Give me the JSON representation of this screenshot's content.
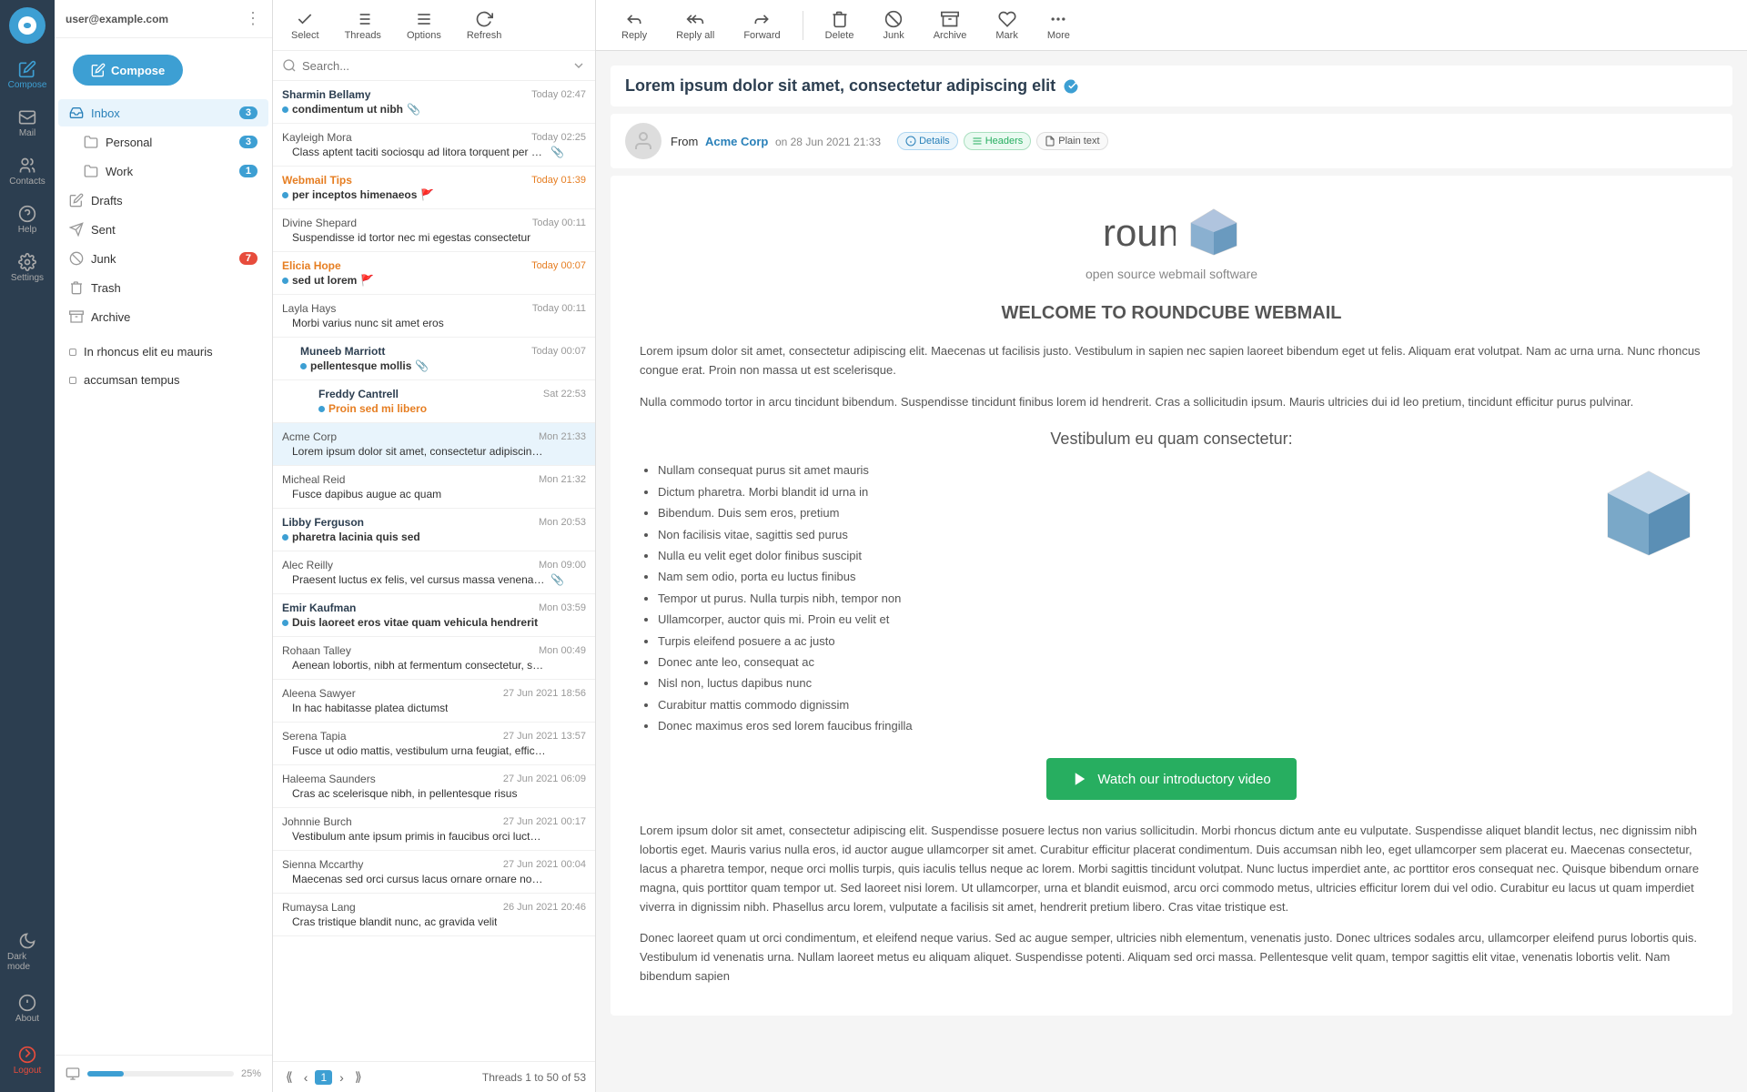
{
  "app": {
    "title": "Roundcube Webmail",
    "user_email": "user@example.com"
  },
  "sidebar": {
    "compose_label": "Compose",
    "nav_items": [
      {
        "id": "compose",
        "label": "Compose",
        "icon": "compose-icon",
        "active": true
      },
      {
        "id": "mail",
        "label": "Mail",
        "icon": "mail-icon"
      },
      {
        "id": "contacts",
        "label": "Contacts",
        "icon": "contacts-icon"
      },
      {
        "id": "help",
        "label": "Help",
        "icon": "help-icon"
      },
      {
        "id": "settings",
        "label": "Settings",
        "icon": "settings-icon"
      }
    ],
    "bottom_items": [
      {
        "id": "darkmode",
        "label": "Dark mode",
        "icon": "moon-icon"
      },
      {
        "id": "about",
        "label": "About",
        "icon": "question-icon"
      },
      {
        "id": "logout",
        "label": "Logout",
        "icon": "power-icon"
      }
    ]
  },
  "folders": {
    "inbox": {
      "label": "Inbox",
      "badge": 3,
      "active": true
    },
    "sub_folders": [
      {
        "label": "Personal",
        "badge": 3
      },
      {
        "label": "Work",
        "badge": 1
      }
    ],
    "drafts": {
      "label": "Drafts",
      "badge": null
    },
    "sent": {
      "label": "Sent",
      "badge": null
    },
    "junk": {
      "label": "Junk",
      "badge": 7
    },
    "trash": {
      "label": "Trash",
      "badge": null
    },
    "archive": {
      "label": "Archive",
      "badge": null
    },
    "custom_folders": [
      {
        "label": "In rhoncus elit eu mauris"
      },
      {
        "label": "accumsan tempus"
      }
    ]
  },
  "toolbar": {
    "buttons": [
      {
        "id": "reply",
        "label": "Reply",
        "icon": "reply-icon"
      },
      {
        "id": "reply-all",
        "label": "Reply all",
        "icon": "reply-all-icon"
      },
      {
        "id": "forward",
        "label": "Forward",
        "icon": "forward-icon"
      },
      {
        "id": "delete",
        "label": "Delete",
        "icon": "delete-icon"
      },
      {
        "id": "junk",
        "label": "Junk",
        "icon": "junk-icon"
      },
      {
        "id": "archive",
        "label": "Archive",
        "icon": "archive-icon"
      },
      {
        "id": "mark",
        "label": "Mark",
        "icon": "mark-icon"
      },
      {
        "id": "more",
        "label": "More",
        "icon": "more-icon"
      }
    ]
  },
  "message_list_toolbar": {
    "select_label": "Select",
    "threads_label": "Threads",
    "options_label": "Options",
    "refresh_label": "Refresh"
  },
  "search": {
    "placeholder": "Search..."
  },
  "messages": [
    {
      "id": 1,
      "sender": "Sharmin Bellamy",
      "subject": "condimentum ut nibh",
      "time": "Today 02:47",
      "unread": true,
      "attachment": true,
      "flag": false,
      "indent": 0,
      "today": false
    },
    {
      "id": 2,
      "sender": "Kayleigh Mora",
      "subject": "Class aptent taciti sociosqu ad litora torquent per conubia nostra",
      "time": "Today 02:25",
      "unread": false,
      "attachment": true,
      "flag": false,
      "indent": 0,
      "today": false
    },
    {
      "id": 3,
      "sender": "Webmail Tips",
      "subject": "per inceptos himenaeos",
      "time": "Today 01:39",
      "unread": true,
      "attachment": false,
      "flag": true,
      "indent": 0,
      "today": true,
      "sender_colored": true
    },
    {
      "id": 4,
      "sender": "Divine Shepard",
      "subject": "Suspendisse id tortor nec mi egestas consectetur",
      "time": "Today 00:11",
      "unread": false,
      "attachment": false,
      "flag": false,
      "indent": 0,
      "today": false
    },
    {
      "id": 5,
      "sender": "Elicia Hope",
      "subject": "sed ut lorem",
      "time": "Today 00:07",
      "unread": true,
      "attachment": false,
      "flag": true,
      "indent": 0,
      "today": true,
      "sender_colored": true
    },
    {
      "id": 6,
      "sender": "Layla Hays",
      "subject": "Morbi varius nunc sit amet eros",
      "time": "Today 00:11",
      "unread": false,
      "attachment": false,
      "flag": false,
      "indent": 0,
      "today": false
    },
    {
      "id": 7,
      "sender": "Muneeb Marriott",
      "subject": "pellentesque mollis",
      "time": "Today 00:07",
      "unread": true,
      "attachment": true,
      "flag": false,
      "indent": 1,
      "today": false
    },
    {
      "id": 8,
      "sender": "Freddy Cantrell",
      "subject": "Proin sed mi libero",
      "time": "Sat 22:53",
      "unread": true,
      "attachment": false,
      "flag": false,
      "indent": 2,
      "today": false,
      "golden": true
    },
    {
      "id": 9,
      "sender": "Acme Corp",
      "subject": "Lorem ipsum dolor sit amet, consectetur adipiscing elit",
      "time": "Mon 21:33",
      "unread": false,
      "attachment": false,
      "flag": false,
      "indent": 0,
      "today": false,
      "selected": true
    },
    {
      "id": 10,
      "sender": "Micheal Reid",
      "subject": "Fusce dapibus augue ac quam",
      "time": "Mon 21:32",
      "unread": false,
      "attachment": false,
      "flag": false,
      "indent": 0,
      "today": false
    },
    {
      "id": 11,
      "sender": "Libby Ferguson",
      "subject": "pharetra lacinia quis sed",
      "time": "Mon 20:53",
      "unread": true,
      "attachment": false,
      "flag": false,
      "indent": 0,
      "today": false
    },
    {
      "id": 12,
      "sender": "Alec Reilly",
      "subject": "Praesent luctus ex felis, vel cursus massa venenatis sit amet",
      "time": "Mon 09:00",
      "unread": false,
      "attachment": true,
      "flag": false,
      "indent": 0,
      "today": false
    },
    {
      "id": 13,
      "sender": "Emir Kaufman",
      "subject": "Duis laoreet eros vitae quam vehicula hendrerit",
      "time": "Mon 03:59",
      "unread": true,
      "attachment": false,
      "flag": false,
      "indent": 0,
      "today": false
    },
    {
      "id": 14,
      "sender": "Rohaan Talley",
      "subject": "Aenean lobortis, nibh at fermentum consectetur, sapien augue vol...",
      "time": "Mon 00:49",
      "unread": false,
      "attachment": false,
      "flag": false,
      "indent": 0,
      "today": false
    },
    {
      "id": 15,
      "sender": "Aleena Sawyer",
      "subject": "In hac habitasse platea dictumst",
      "time": "27 Jun 2021 18:56",
      "unread": false,
      "attachment": false,
      "flag": false,
      "indent": 0,
      "today": false
    },
    {
      "id": 16,
      "sender": "Serena Tapia",
      "subject": "Fusce ut odio mattis, vestibulum urna feugiat, efficitur nibh",
      "time": "27 Jun 2021 13:57",
      "unread": false,
      "attachment": false,
      "flag": false,
      "indent": 0,
      "today": false
    },
    {
      "id": 17,
      "sender": "Haleema Saunders",
      "subject": "Cras ac scelerisque nibh, in pellentesque risus",
      "time": "27 Jun 2021 06:09",
      "unread": false,
      "attachment": false,
      "flag": false,
      "indent": 0,
      "today": false
    },
    {
      "id": 18,
      "sender": "Johnnie Burch",
      "subject": "Vestibulum ante ipsum primis in faucibus orci luctus et ultrices pos...",
      "time": "27 Jun 2021 00:17",
      "unread": false,
      "attachment": false,
      "flag": false,
      "indent": 0,
      "today": false
    },
    {
      "id": 19,
      "sender": "Sienna Mccarthy",
      "subject": "Maecenas sed orci cursus lacus ornare ornare non eu lectus",
      "time": "27 Jun 2021 00:04",
      "unread": false,
      "attachment": false,
      "flag": false,
      "indent": 0,
      "today": false
    },
    {
      "id": 20,
      "sender": "Rumaysa Lang",
      "subject": "Cras tristique blandit nunc, ac gravida velit",
      "time": "26 Jun 2021 20:46",
      "unread": false,
      "attachment": false,
      "flag": false,
      "indent": 0,
      "today": false
    }
  ],
  "pagination": {
    "range": "Threads 1 to 50 of 53",
    "current_page": 1
  },
  "email": {
    "subject": "Lorem ipsum dolor sit amet, consectetur adipiscing elit",
    "from_label": "From",
    "from_name": "Acme Corp",
    "from_email": "Acme Corp",
    "date": "on 28 Jun 2021 21:33",
    "tags": [
      {
        "label": "Details",
        "icon": "info-icon",
        "type": "blue"
      },
      {
        "label": "Headers",
        "icon": "list-icon",
        "type": "green"
      },
      {
        "label": "Plain text",
        "icon": "text-icon",
        "type": "gray"
      }
    ],
    "body": {
      "logo_main": "roundcube",
      "logo_sub": "open source webmail software",
      "welcome_title": "WELCOME TO ROUNDCUBE WEBMAIL",
      "intro_p1": "Lorem ipsum dolor sit amet, consectetur adipiscing elit. Maecenas ut facilisis justo. Vestibulum in sapien nec sapien laoreet bibendum eget ut felis. Aliquam erat volutpat. Nam ac urna urna. Nunc rhoncus congue erat. Proin non massa ut est scelerisque.",
      "intro_p2": "Nulla commodo tortor in arcu tincidunt bibendum. Suspendisse tincidunt finibus lorem id hendrerit. Cras a sollicitudin ipsum. Mauris ultricies dui id leo pretium, tincidunt efficitur purus pulvinar.",
      "section_title": "Vestibulum eu quam consectetur:",
      "list_items": [
        "Nullam consequat purus sit amet mauris",
        "Dictum pharetra. Morbi blandit id urna in",
        "Bibendum. Duis sem eros, pretium",
        "Non facilisis vitae, sagittis sed purus",
        "Nulla eu velit eget dolor finibus suscipit",
        "Nam sem odio, porta eu luctus finibus",
        "Tempor ut purus. Nulla turpis nibh, tempor non",
        "Ullamcorper, auctor quis mi. Proin eu velit et",
        "Turpis eleifend posuere a ac justo",
        "Donec ante leo, consequat ac",
        "Nisl non, luctus dapibus nunc",
        "Curabitur mattis commodo dignissim",
        "Donec maximus eros sed lorem faucibus fringilla"
      ],
      "video_btn_label": "Watch our introductory video",
      "body_long": "Lorem ipsum dolor sit amet, consectetur adipiscing elit. Suspendisse posuere lectus non varius sollicitudin. Morbi rhoncus dictum ante eu vulputate. Suspendisse aliquet blandit lectus, nec dignissim nibh lobortis eget. Mauris varius nulla eros, id auctor augue ullamcorper sit amet. Curabitur efficitur placerat condimentum. Duis accumsan nibh leo, eget ullamcorper sem placerat eu. Maecenas consectetur, lacus a pharetra tempor, neque orci mollis turpis, quis iaculis tellus neque ac lorem. Morbi sagittis tincidunt volutpat. Nunc luctus imperdiet ante, ac porttitor eros consequat nec. Quisque bibendum ornare magna, quis porttitor quam tempor ut. Sed laoreet nisi lorem. Ut ullamcorper, urna et blandit euismod, arcu orci commodo metus, ultricies efficitur lorem dui vel odio. Curabitur eu lacus ut quam imperdiet viverra in dignissim nibh. Phasellus arcu lorem, vulputate a facilisis sit amet, hendrerit pretium libero. Cras vitae tristique est.",
      "body_long2": "Donec laoreet quam ut orci condimentum, et eleifend neque varius. Sed ac augue semper, ultricies nibh elementum, venenatis justo. Donec ultrices sodales arcu, ullamcorper eleifend purus lobortis quis. Vestibulum id venenatis urna. Nullam laoreet metus eu aliquam aliquet. Suspendisse potenti. Aliquam sed orci massa. Pellentesque velit quam, tempor sagittis elit vitae, venenatis lobortis velit. Nam bibendum sapien"
    }
  }
}
